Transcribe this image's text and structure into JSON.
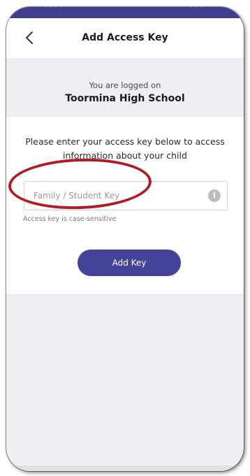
{
  "status_bar": {
    "left_text": "· · · ·",
    "right_text": "· · ·"
  },
  "header": {
    "back_icon": "chevron-left-icon",
    "title": "Add Access Key"
  },
  "login_info": {
    "subtitle": "You are logged on",
    "school_name": "Toormina High School"
  },
  "form": {
    "instructions": "Please enter your access key below to access information about your child",
    "key_input": {
      "placeholder": "Family / Student Key",
      "value": ""
    },
    "info_icon": "info-icon",
    "info_glyph": "i",
    "hint": "Access key is case-sensitive",
    "submit_label": "Add Key"
  },
  "colors": {
    "primary": "#45429a",
    "status_bar": "#3f3f8f",
    "background": "#efeff3",
    "annotation": "#b11c22"
  }
}
